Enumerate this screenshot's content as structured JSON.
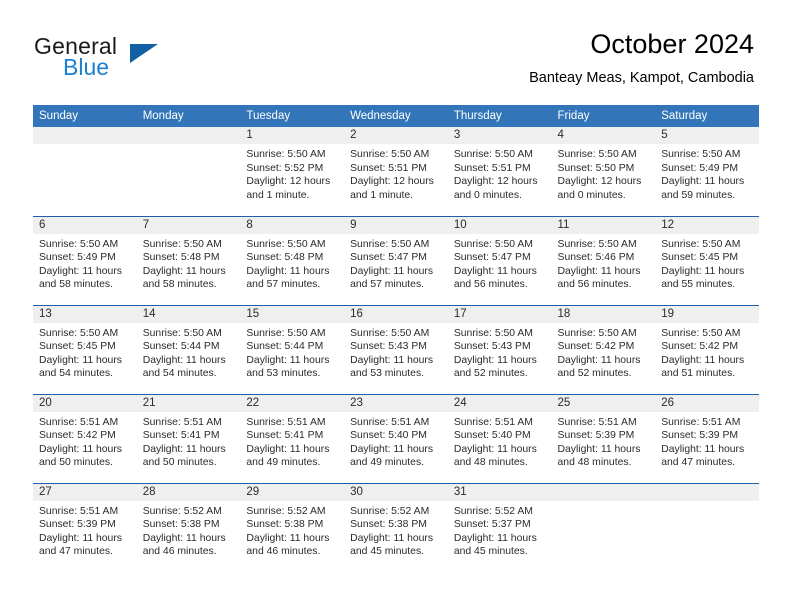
{
  "branding": {
    "name_part1": "General",
    "name_part2": "Blue",
    "logo_icon": "triangle-logo-icon",
    "accent_color": "#1160a5",
    "blue_text_color": "#1b7fd0"
  },
  "header": {
    "title": "October 2024",
    "subtitle": "Banteay Meas, Kampot, Cambodia"
  },
  "theme": {
    "header_row_bg": "#3275b8",
    "row_separator": "#1f5fa9",
    "daynum_strip_bg": "#efefef",
    "text_color": "#2b2b2b"
  },
  "calendar": {
    "weekday_headers": [
      "Sunday",
      "Monday",
      "Tuesday",
      "Wednesday",
      "Thursday",
      "Friday",
      "Saturday"
    ],
    "weeks": [
      [
        {
          "day": "",
          "empty": true
        },
        {
          "day": "",
          "empty": true
        },
        {
          "day": "1",
          "sunrise": "Sunrise: 5:50 AM",
          "sunset": "Sunset: 5:52 PM",
          "daylight1": "Daylight: 12 hours",
          "daylight2": "and 1 minute."
        },
        {
          "day": "2",
          "sunrise": "Sunrise: 5:50 AM",
          "sunset": "Sunset: 5:51 PM",
          "daylight1": "Daylight: 12 hours",
          "daylight2": "and 1 minute."
        },
        {
          "day": "3",
          "sunrise": "Sunrise: 5:50 AM",
          "sunset": "Sunset: 5:51 PM",
          "daylight1": "Daylight: 12 hours",
          "daylight2": "and 0 minutes."
        },
        {
          "day": "4",
          "sunrise": "Sunrise: 5:50 AM",
          "sunset": "Sunset: 5:50 PM",
          "daylight1": "Daylight: 12 hours",
          "daylight2": "and 0 minutes."
        },
        {
          "day": "5",
          "sunrise": "Sunrise: 5:50 AM",
          "sunset": "Sunset: 5:49 PM",
          "daylight1": "Daylight: 11 hours",
          "daylight2": "and 59 minutes."
        }
      ],
      [
        {
          "day": "6",
          "sunrise": "Sunrise: 5:50 AM",
          "sunset": "Sunset: 5:49 PM",
          "daylight1": "Daylight: 11 hours",
          "daylight2": "and 58 minutes."
        },
        {
          "day": "7",
          "sunrise": "Sunrise: 5:50 AM",
          "sunset": "Sunset: 5:48 PM",
          "daylight1": "Daylight: 11 hours",
          "daylight2": "and 58 minutes."
        },
        {
          "day": "8",
          "sunrise": "Sunrise: 5:50 AM",
          "sunset": "Sunset: 5:48 PM",
          "daylight1": "Daylight: 11 hours",
          "daylight2": "and 57 minutes."
        },
        {
          "day": "9",
          "sunrise": "Sunrise: 5:50 AM",
          "sunset": "Sunset: 5:47 PM",
          "daylight1": "Daylight: 11 hours",
          "daylight2": "and 57 minutes."
        },
        {
          "day": "10",
          "sunrise": "Sunrise: 5:50 AM",
          "sunset": "Sunset: 5:47 PM",
          "daylight1": "Daylight: 11 hours",
          "daylight2": "and 56 minutes."
        },
        {
          "day": "11",
          "sunrise": "Sunrise: 5:50 AM",
          "sunset": "Sunset: 5:46 PM",
          "daylight1": "Daylight: 11 hours",
          "daylight2": "and 56 minutes."
        },
        {
          "day": "12",
          "sunrise": "Sunrise: 5:50 AM",
          "sunset": "Sunset: 5:45 PM",
          "daylight1": "Daylight: 11 hours",
          "daylight2": "and 55 minutes."
        }
      ],
      [
        {
          "day": "13",
          "sunrise": "Sunrise: 5:50 AM",
          "sunset": "Sunset: 5:45 PM",
          "daylight1": "Daylight: 11 hours",
          "daylight2": "and 54 minutes."
        },
        {
          "day": "14",
          "sunrise": "Sunrise: 5:50 AM",
          "sunset": "Sunset: 5:44 PM",
          "daylight1": "Daylight: 11 hours",
          "daylight2": "and 54 minutes."
        },
        {
          "day": "15",
          "sunrise": "Sunrise: 5:50 AM",
          "sunset": "Sunset: 5:44 PM",
          "daylight1": "Daylight: 11 hours",
          "daylight2": "and 53 minutes."
        },
        {
          "day": "16",
          "sunrise": "Sunrise: 5:50 AM",
          "sunset": "Sunset: 5:43 PM",
          "daylight1": "Daylight: 11 hours",
          "daylight2": "and 53 minutes."
        },
        {
          "day": "17",
          "sunrise": "Sunrise: 5:50 AM",
          "sunset": "Sunset: 5:43 PM",
          "daylight1": "Daylight: 11 hours",
          "daylight2": "and 52 minutes."
        },
        {
          "day": "18",
          "sunrise": "Sunrise: 5:50 AM",
          "sunset": "Sunset: 5:42 PM",
          "daylight1": "Daylight: 11 hours",
          "daylight2": "and 52 minutes."
        },
        {
          "day": "19",
          "sunrise": "Sunrise: 5:50 AM",
          "sunset": "Sunset: 5:42 PM",
          "daylight1": "Daylight: 11 hours",
          "daylight2": "and 51 minutes."
        }
      ],
      [
        {
          "day": "20",
          "sunrise": "Sunrise: 5:51 AM",
          "sunset": "Sunset: 5:42 PM",
          "daylight1": "Daylight: 11 hours",
          "daylight2": "and 50 minutes."
        },
        {
          "day": "21",
          "sunrise": "Sunrise: 5:51 AM",
          "sunset": "Sunset: 5:41 PM",
          "daylight1": "Daylight: 11 hours",
          "daylight2": "and 50 minutes."
        },
        {
          "day": "22",
          "sunrise": "Sunrise: 5:51 AM",
          "sunset": "Sunset: 5:41 PM",
          "daylight1": "Daylight: 11 hours",
          "daylight2": "and 49 minutes."
        },
        {
          "day": "23",
          "sunrise": "Sunrise: 5:51 AM",
          "sunset": "Sunset: 5:40 PM",
          "daylight1": "Daylight: 11 hours",
          "daylight2": "and 49 minutes."
        },
        {
          "day": "24",
          "sunrise": "Sunrise: 5:51 AM",
          "sunset": "Sunset: 5:40 PM",
          "daylight1": "Daylight: 11 hours",
          "daylight2": "and 48 minutes."
        },
        {
          "day": "25",
          "sunrise": "Sunrise: 5:51 AM",
          "sunset": "Sunset: 5:39 PM",
          "daylight1": "Daylight: 11 hours",
          "daylight2": "and 48 minutes."
        },
        {
          "day": "26",
          "sunrise": "Sunrise: 5:51 AM",
          "sunset": "Sunset: 5:39 PM",
          "daylight1": "Daylight: 11 hours",
          "daylight2": "and 47 minutes."
        }
      ],
      [
        {
          "day": "27",
          "sunrise": "Sunrise: 5:51 AM",
          "sunset": "Sunset: 5:39 PM",
          "daylight1": "Daylight: 11 hours",
          "daylight2": "and 47 minutes."
        },
        {
          "day": "28",
          "sunrise": "Sunrise: 5:52 AM",
          "sunset": "Sunset: 5:38 PM",
          "daylight1": "Daylight: 11 hours",
          "daylight2": "and 46 minutes."
        },
        {
          "day": "29",
          "sunrise": "Sunrise: 5:52 AM",
          "sunset": "Sunset: 5:38 PM",
          "daylight1": "Daylight: 11 hours",
          "daylight2": "and 46 minutes."
        },
        {
          "day": "30",
          "sunrise": "Sunrise: 5:52 AM",
          "sunset": "Sunset: 5:38 PM",
          "daylight1": "Daylight: 11 hours",
          "daylight2": "and 45 minutes."
        },
        {
          "day": "31",
          "sunrise": "Sunrise: 5:52 AM",
          "sunset": "Sunset: 5:37 PM",
          "daylight1": "Daylight: 11 hours",
          "daylight2": "and 45 minutes."
        },
        {
          "day": "",
          "empty": true
        },
        {
          "day": "",
          "empty": true
        }
      ]
    ]
  }
}
